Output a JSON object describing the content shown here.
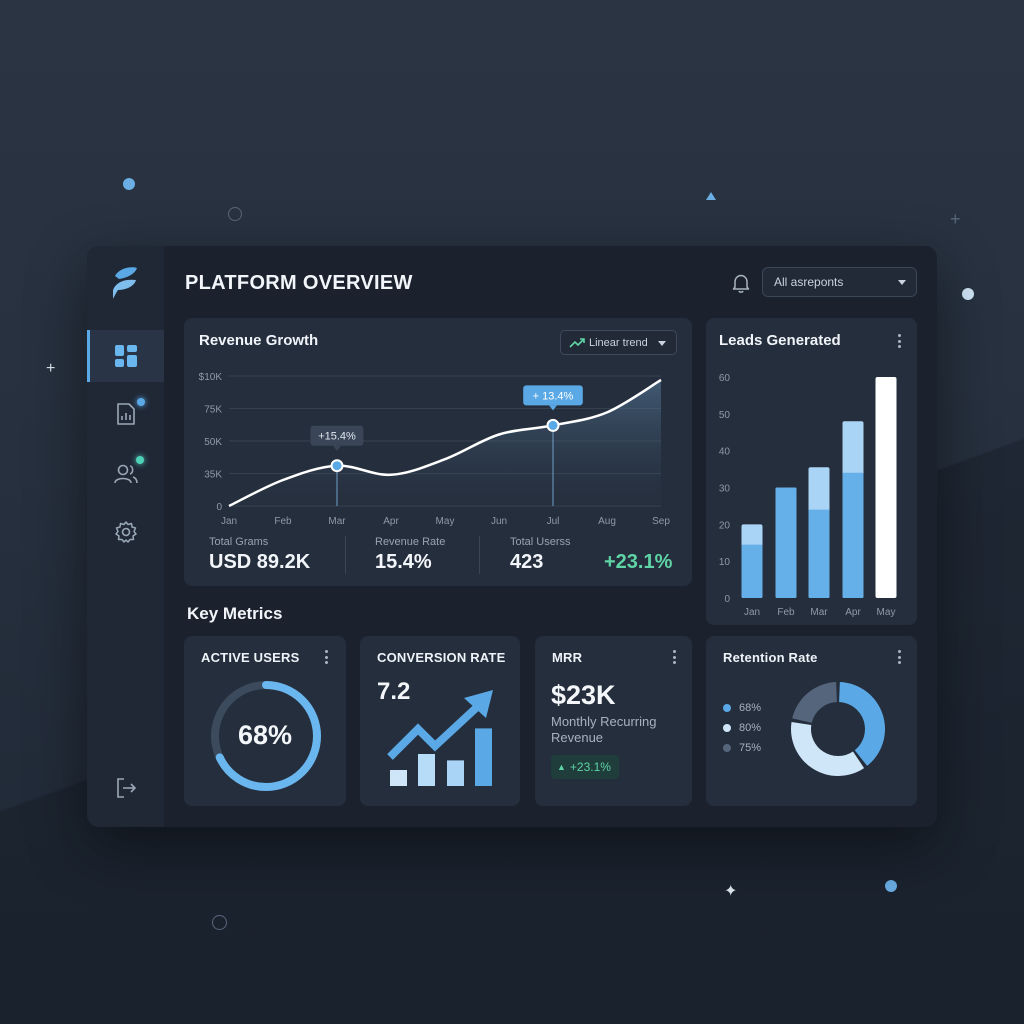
{
  "app": {
    "title": "PLATFORM OVERVIEW"
  },
  "header": {
    "filter_value": "All asreponts"
  },
  "sidebar": {
    "items": [
      {
        "name": "dashboard",
        "icon": "dashboard-icon",
        "active": true
      },
      {
        "name": "reports",
        "icon": "report-icon",
        "badge_color": "#5aa9e6"
      },
      {
        "name": "users",
        "icon": "users-icon",
        "badge_color": "#4fd1b8"
      },
      {
        "name": "settings",
        "icon": "gear-icon"
      }
    ],
    "footer_icon": "logout-icon"
  },
  "revenue": {
    "title": "Revenue Growth",
    "trend_button": "Linear trend",
    "callouts": [
      "+15.4%",
      "+ 13.4%"
    ],
    "stats": [
      {
        "label": "Total Grams",
        "value": "USD 89.2K"
      },
      {
        "label": "Revenue Rate",
        "value": "15.4%"
      },
      {
        "label": "Total Userss",
        "value": "423"
      }
    ],
    "change": "+23.1%"
  },
  "leads": {
    "title": "Leads Generated"
  },
  "key_metrics": {
    "title": "Key Metrics",
    "active_users": {
      "title": "ACTIVE USERS",
      "value": "68%",
      "progress": 0.68
    },
    "conversion": {
      "title": "CONVERSION RATE",
      "value": "7.2"
    },
    "mrr": {
      "title": "MRR",
      "value": "$23K",
      "subtitle": "Monthly Recurring Revenue",
      "change": "+23.1%"
    },
    "retention": {
      "title": "Retention Rate",
      "legend": [
        {
          "label": "68%",
          "color": "#5aa9e6"
        },
        {
          "label": "80%",
          "color": "#cfe6f8"
        },
        {
          "label": "75%",
          "color": "#55657b"
        }
      ]
    }
  },
  "colors": {
    "accent": "#5aa9e6",
    "positive": "#5fd4a6",
    "bar_light": "#a9d4f5",
    "bar_white": "#ffffff"
  },
  "chart_data": [
    {
      "type": "line",
      "title": "Revenue Growth",
      "x": [
        "Jan",
        "Feb",
        "Mar",
        "Apr",
        "May",
        "Jun",
        "Jul",
        "Aug",
        "Sep"
      ],
      "y_tick_labels": [
        "0",
        "35K",
        "50K",
        "75K",
        "$10K"
      ],
      "y_ticks": [
        0,
        25,
        50,
        75,
        100
      ],
      "values": [
        0,
        20,
        31,
        24,
        36,
        55,
        62,
        72,
        97
      ],
      "ylim": [
        0,
        100
      ],
      "grid": true
    },
    {
      "type": "bar",
      "title": "Leads Generated",
      "categories": [
        "Jan",
        "Feb",
        "Mar",
        "Apr",
        "May"
      ],
      "values": [
        20,
        30,
        35.5,
        48,
        60
      ],
      "inner_values": [
        14.5,
        30,
        24,
        34,
        60
      ],
      "ylim": [
        0,
        60
      ],
      "y_ticks": [
        0,
        10,
        20,
        30,
        40,
        50,
        60
      ],
      "grid": false
    },
    {
      "type": "bar",
      "title": "CONVERSION RATE",
      "values": [
        1,
        2,
        1.6,
        3.6
      ],
      "categories": [
        "",
        "",
        "",
        ""
      ]
    },
    {
      "type": "pie",
      "title": "Retention Rate",
      "categories": [
        "68%",
        "80%",
        "75%"
      ],
      "values": [
        40,
        38,
        22
      ],
      "colors": [
        "#5aa9e6",
        "#cfe6f8",
        "#55657b"
      ]
    }
  ]
}
